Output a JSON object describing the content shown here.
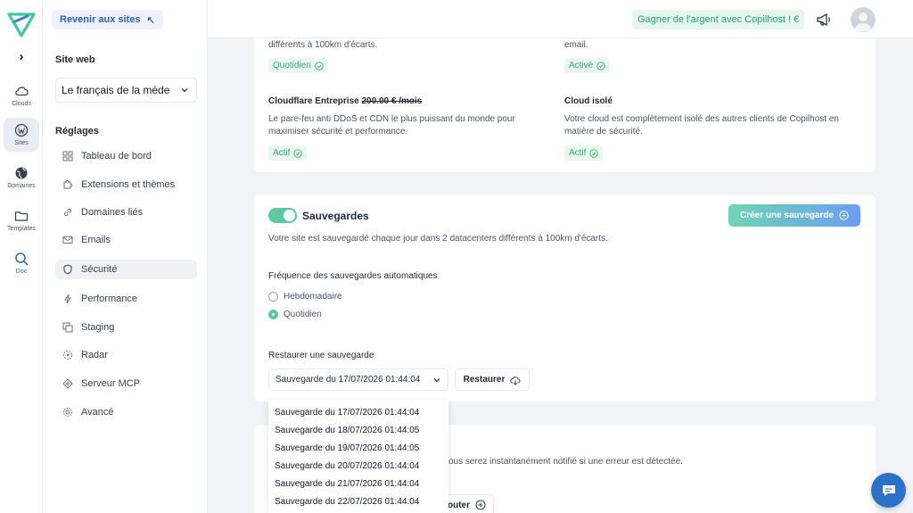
{
  "rail": {
    "items": [
      {
        "label": "Clouds",
        "icon": "cloud-icon"
      },
      {
        "label": "Sites",
        "icon": "wordpress-icon"
      },
      {
        "label": "Domaines",
        "icon": "globe-icon"
      },
      {
        "label": "Templates",
        "icon": "folder-icon"
      },
      {
        "label": "Doc",
        "icon": "search-icon"
      }
    ]
  },
  "sidebar": {
    "back_label": "Revenir aux sites",
    "site_title": "Site web",
    "site_name": "Le français de la méde",
    "settings_title": "Réglages",
    "items": [
      {
        "label": "Tableau de bord",
        "icon": "dashboard-icon"
      },
      {
        "label": "Extensions et thèmes",
        "icon": "puzzle-icon"
      },
      {
        "label": "Domaines liés",
        "icon": "link-icon"
      },
      {
        "label": "Emails",
        "icon": "mail-icon"
      },
      {
        "label": "Sécurité",
        "icon": "shield-icon"
      },
      {
        "label": "Performance",
        "icon": "bolt-icon"
      },
      {
        "label": "Staging",
        "icon": "copy-icon"
      },
      {
        "label": "Radar",
        "icon": "radar-icon"
      },
      {
        "label": "Serveur MCP",
        "icon": "mcp-icon"
      },
      {
        "label": "Avancé",
        "icon": "gear-icon"
      }
    ]
  },
  "topbar": {
    "earn_label": "Gagner de l'argent avec Copilhost ! €"
  },
  "security_card": {
    "top_left_text": "différents à 100km d'écarts.",
    "top_left_badge": "Quotidien",
    "top_right_text": "email.",
    "top_right_badge": "Activé",
    "cloudflare_title": "Cloudflare Entreprise",
    "cloudflare_price": "200.00 € /mois",
    "cloudflare_desc_1": "Le pare-feu anti DDoS et CDN le plus puissant du monde pour",
    "cloudflare_desc_2": "maximiser sécurité et performance.",
    "cloudflare_badge": "Actif",
    "isolated_title": "Cloud isolé",
    "isolated_desc_1": "Votre cloud est complètement isolé des autres clients de Copilhost en",
    "isolated_desc_2": "matière de sécurité.",
    "isolated_badge": "Actif"
  },
  "backups": {
    "title": "Sauvegardes",
    "enabled": true,
    "create_label": "Créer une sauvegarde",
    "description": "Votre site est sauvegardé chaque jour dans 2 datacenters différents à 100km d'écarts.",
    "frequency_label": "Fréquence des sauvegardes automatiques",
    "frequency_options": [
      "Hebdomadaire",
      "Quotidien"
    ],
    "frequency_selected": "Quotidien",
    "restore_label": "Restaurer une sauvegarde",
    "selected_backup": "Sauvegarde du 17/07/2026 01:44:04",
    "restore_button": "Restaurer",
    "dropdown_options": [
      "Sauvegarde du 17/07/2026 01:44:04",
      "Sauvegarde du 18/07/2026 01:44:05",
      "Sauvegarde du 19/07/2026 01:44:05",
      "Sauvegarde du 20/07/2026 01:44:04",
      "Sauvegarde du 21/07/2026 01:44:04",
      "Sauvegarde du 22/07/2026 01:44:04"
    ]
  },
  "monitoring": {
    "partial_text": "ous serez instantanément notifié si une erreur est détectée.",
    "add_label": "outer"
  },
  "colors": {
    "accent_green": "#5cc9a0",
    "accent_blue": "#2b5fb8",
    "chat_blue": "#2a72c8"
  }
}
